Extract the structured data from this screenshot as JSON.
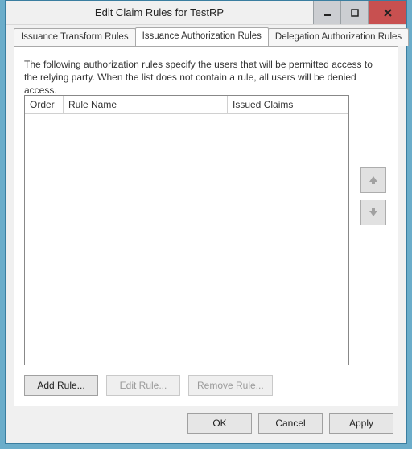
{
  "window": {
    "title": "Edit Claim Rules for TestRP"
  },
  "tabs": [
    {
      "label": "Issuance Transform Rules"
    },
    {
      "label": "Issuance Authorization Rules"
    },
    {
      "label": "Delegation Authorization Rules"
    }
  ],
  "panel": {
    "description": "The following authorization rules specify the users that will be permitted access to the relying party. When the list does not contain a rule, all users will be denied access.",
    "columns": {
      "order": "Order",
      "rule_name": "Rule Name",
      "issued_claims": "Issued Claims"
    },
    "rows": []
  },
  "rule_buttons": {
    "add": "Add Rule...",
    "edit": "Edit Rule...",
    "remove": "Remove Rule..."
  },
  "dialog_buttons": {
    "ok": "OK",
    "cancel": "Cancel",
    "apply": "Apply"
  }
}
